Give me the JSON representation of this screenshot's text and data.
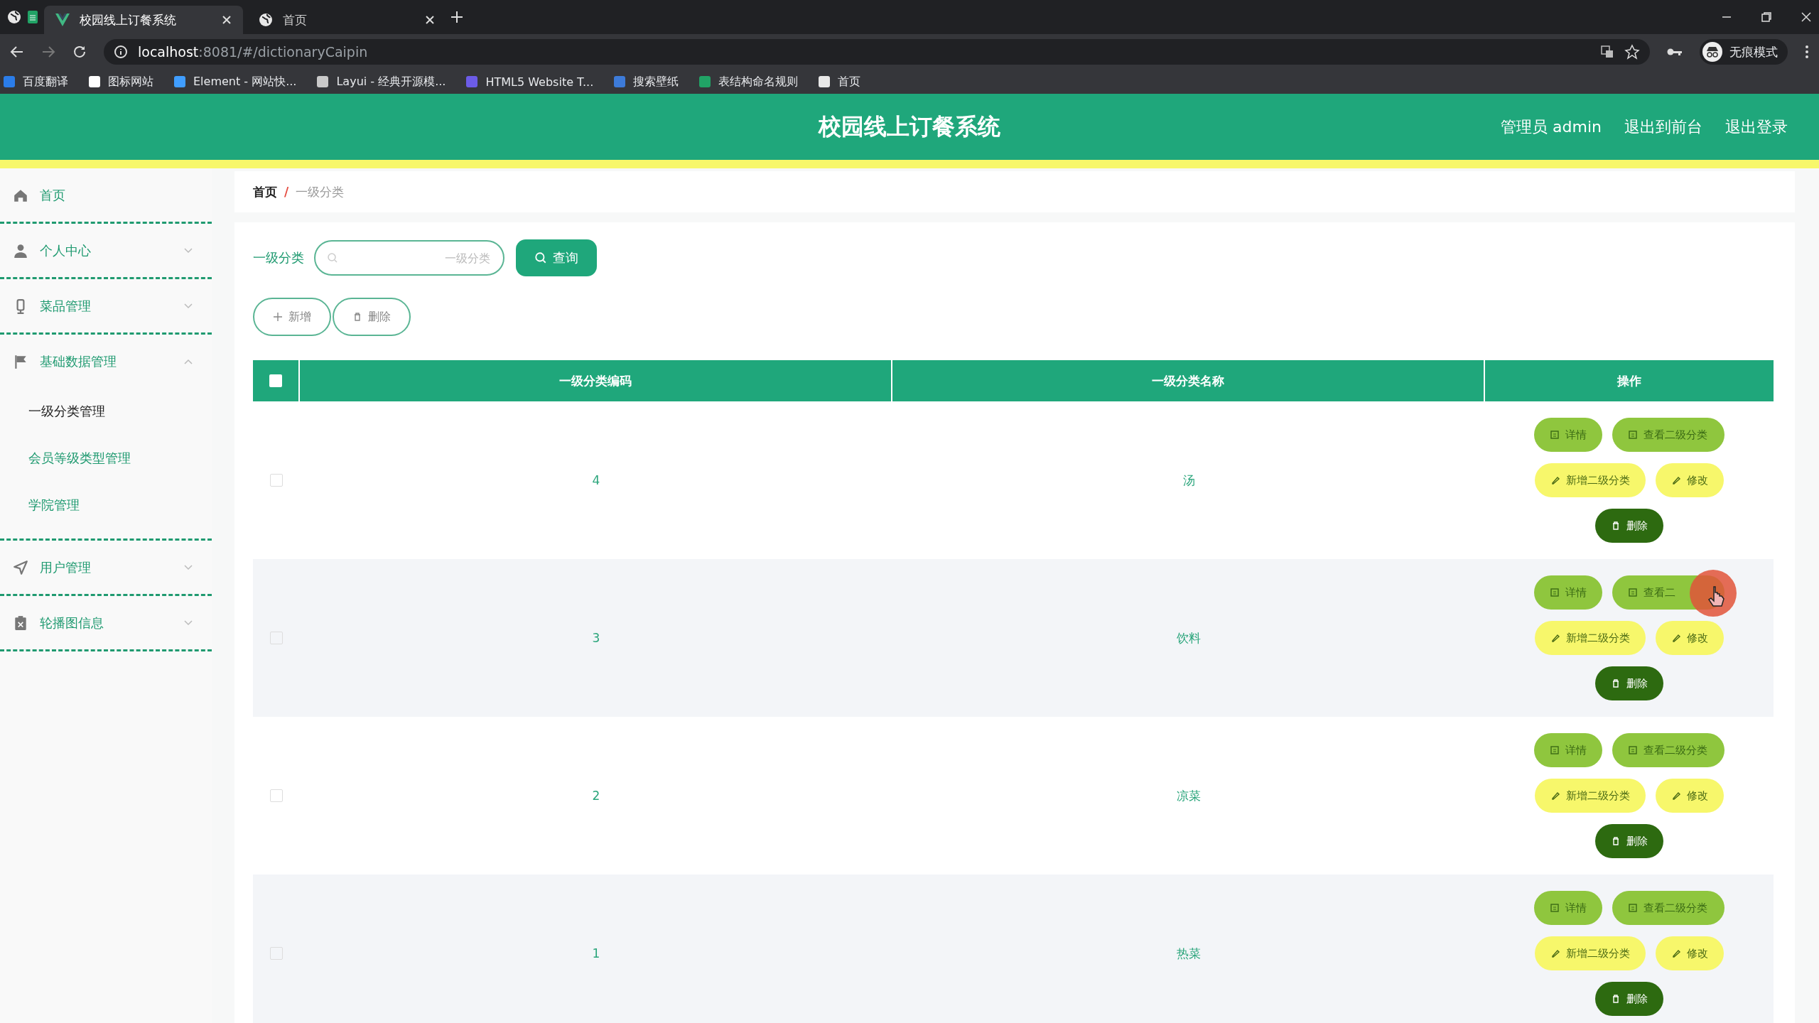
{
  "browser": {
    "tabs": [
      {
        "title": "校园线上订餐系统",
        "selected": true
      },
      {
        "title": "首页",
        "selected": false
      }
    ],
    "address": {
      "host": "localhost",
      "rest": ":8081/#/dictionaryCaipin"
    },
    "bookmarks": [
      {
        "label": "百度翻译",
        "color": "#2b7de9"
      },
      {
        "label": "图标网站",
        "color": "#ffffff"
      },
      {
        "label": "Element - 网站快...",
        "color": "#409eff"
      },
      {
        "label": "Layui - 经典开源模...",
        "color": "#c9c9c9"
      },
      {
        "label": "HTML5 Website T...",
        "color": "#6c5ce7"
      },
      {
        "label": "搜索壁纸",
        "color": "#3d7bd9"
      },
      {
        "label": "表结构命名规则",
        "color": "#21a366"
      },
      {
        "label": "首页",
        "color": "#e8e8e8"
      }
    ],
    "profile": "无痕模式"
  },
  "header": {
    "title": "校园线上订餐系统",
    "user": "管理员 admin",
    "links": [
      "退出到前台",
      "退出登录"
    ]
  },
  "sidebar": {
    "items": [
      {
        "label": "首页"
      },
      {
        "label": "个人中心",
        "expanded": false
      },
      {
        "label": "菜品管理",
        "expanded": false
      },
      {
        "label": "基础数据管理",
        "expanded": true,
        "children": [
          {
            "label": "一级分类管理",
            "selected": true
          },
          {
            "label": "会员等级类型管理",
            "selected": false
          },
          {
            "label": "学院管理",
            "selected": false
          }
        ]
      },
      {
        "label": "用户管理",
        "expanded": false
      },
      {
        "label": "轮播图信息",
        "expanded": false
      }
    ]
  },
  "breadcrumb": {
    "items": [
      "首页",
      "一级分类"
    ],
    "separator": "/"
  },
  "search": {
    "label": "一级分类",
    "placeholder": "一级分类",
    "button": "查询"
  },
  "toolbar": [
    {
      "label": "新增",
      "kind": "add"
    },
    {
      "label": "删除",
      "kind": "delete"
    }
  ],
  "table": {
    "header_checked": false,
    "columns": [
      "一级分类编码",
      "一级分类名称",
      "操作"
    ],
    "rows": [
      {
        "checked": false,
        "code": "4",
        "name": "汤",
        "actions": [
          {
            "label": "详情",
            "kind": "detail"
          },
          {
            "label": "查看二级分类",
            "kind": "view"
          },
          {
            "label": "新增二级分类",
            "kind": "add"
          },
          {
            "label": "修改",
            "kind": "edit"
          },
          {
            "label": "删除",
            "kind": "delete"
          }
        ]
      },
      {
        "checked": false,
        "code": "3",
        "name": "饮料",
        "actions": [
          {
            "label": "详情",
            "kind": "detail"
          },
          {
            "label": "查看二",
            "kind": "view"
          },
          {
            "label": "新增二级分类",
            "kind": "add"
          },
          {
            "label": "修改",
            "kind": "edit"
          },
          {
            "label": "删除",
            "kind": "delete"
          }
        ]
      },
      {
        "checked": false,
        "code": "2",
        "name": "凉菜",
        "actions": [
          {
            "label": "详情",
            "kind": "detail"
          },
          {
            "label": "查看二级分类",
            "kind": "view"
          },
          {
            "label": "新增二级分类",
            "kind": "add"
          },
          {
            "label": "修改",
            "kind": "edit"
          },
          {
            "label": "删除",
            "kind": "delete"
          }
        ]
      },
      {
        "checked": false,
        "code": "1",
        "name": "热菜",
        "actions": [
          {
            "label": "详情",
            "kind": "detail"
          },
          {
            "label": "查看二级分类",
            "kind": "view"
          },
          {
            "label": "新增二级分类",
            "kind": "add"
          },
          {
            "label": "修改",
            "kind": "edit"
          },
          {
            "label": "删除",
            "kind": "delete"
          }
        ]
      }
    ]
  }
}
